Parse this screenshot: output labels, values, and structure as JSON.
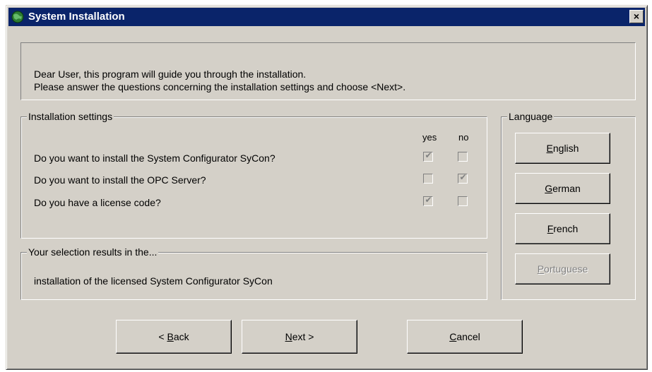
{
  "window": {
    "title": "System Installation",
    "close_label": "×"
  },
  "intro": {
    "line1": "Dear User, this program will guide you through the installation.",
    "line2": "Please answer the questions concerning the installation settings and choose <Next>."
  },
  "settings": {
    "group_label": "Installation settings",
    "col_yes": "yes",
    "col_no": "no",
    "questions": [
      {
        "text": "Do you want to install the System Configurator SyCon?",
        "yes": true,
        "no": false
      },
      {
        "text": "Do you want to install the OPC Server?",
        "yes": false,
        "no": true
      },
      {
        "text": "Do you have a license code?",
        "yes": true,
        "no": false
      }
    ]
  },
  "results": {
    "group_label": "Your selection results in the...",
    "text": "installation of the licensed System Configurator SyCon"
  },
  "language": {
    "group_label": "Language",
    "buttons": [
      {
        "mnemonic": "E",
        "rest": "nglish",
        "enabled": true
      },
      {
        "mnemonic": "G",
        "rest": "erman",
        "enabled": true
      },
      {
        "mnemonic": "F",
        "rest": "rench",
        "enabled": true
      },
      {
        "mnemonic": "P",
        "rest": "ortuguese",
        "enabled": false
      }
    ]
  },
  "nav": {
    "back_prefix": "< ",
    "back_mnemonic": "B",
    "back_rest": "ack",
    "next_mnemonic": "N",
    "next_rest": "ext >",
    "cancel_mnemonic": "C",
    "cancel_rest": "ancel"
  },
  "colors": {
    "titlebar": "#0a246a",
    "face": "#d4d0c8"
  }
}
